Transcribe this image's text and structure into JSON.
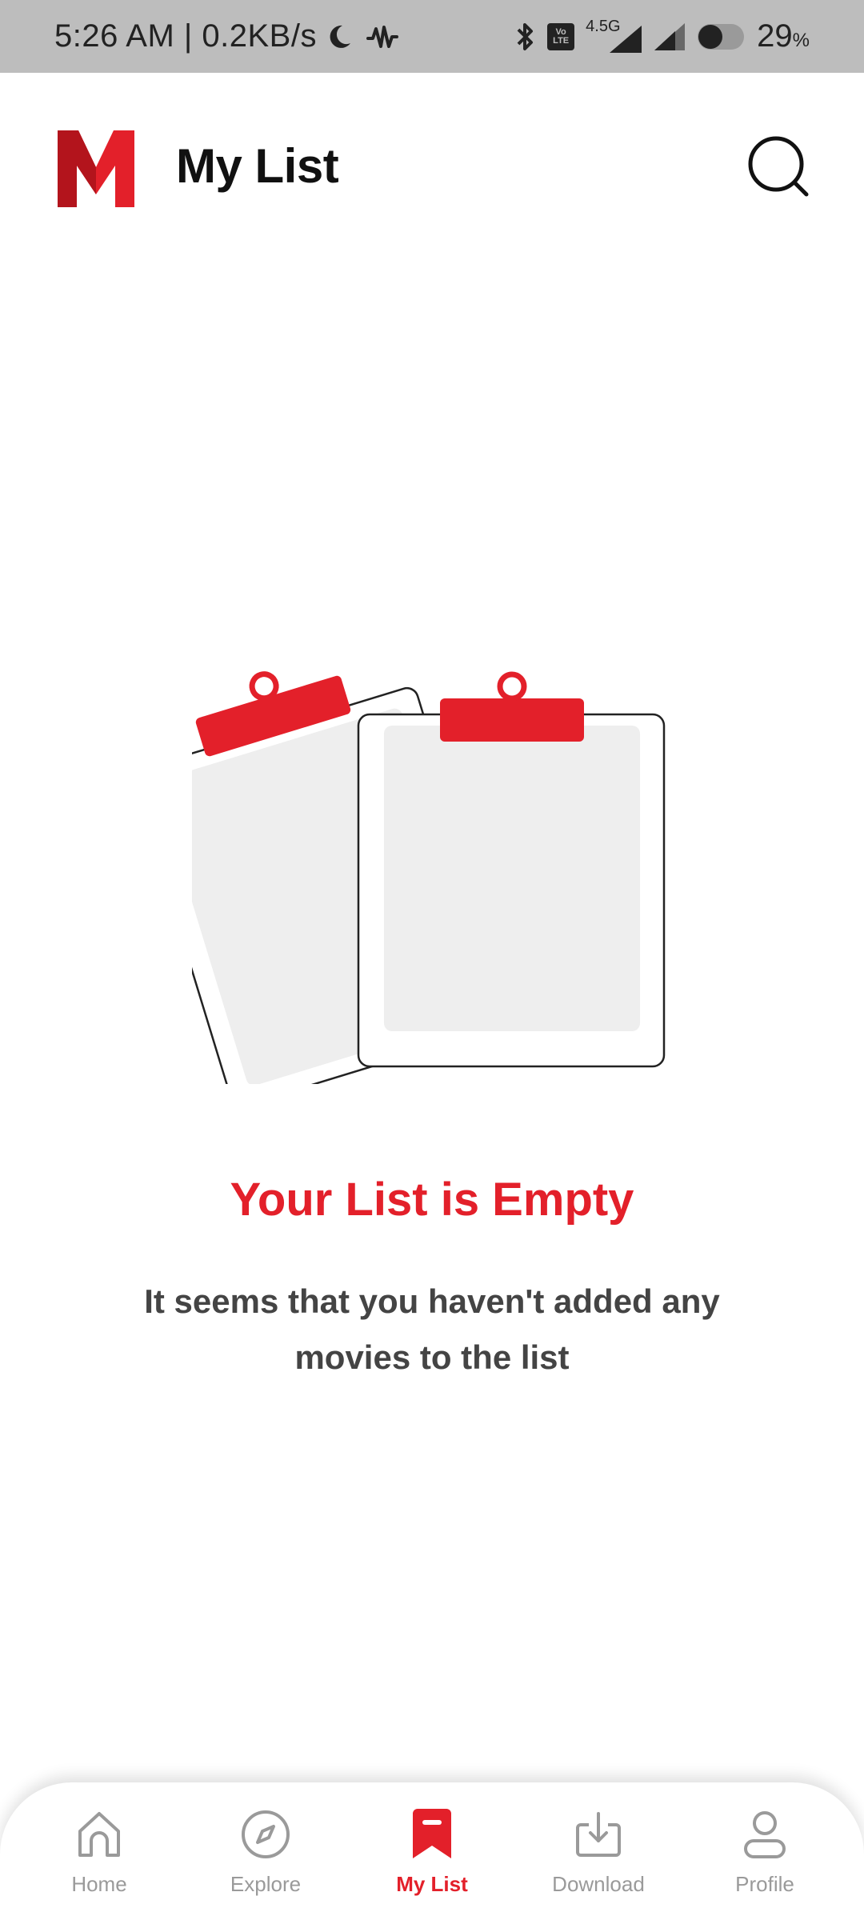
{
  "status_bar": {
    "time_speed": "5:26 AM | 0.2KB/s",
    "network_label": "4.5G",
    "volte_label": "Vo LTE",
    "battery_percent": "29",
    "battery_unit": "%"
  },
  "header": {
    "title": "My List",
    "logo_text": "M"
  },
  "empty_state": {
    "title": "Your List is Empty",
    "description": "It seems that you haven't added any movies to the list"
  },
  "bottom_nav": {
    "items": [
      {
        "label": "Home",
        "icon": "home-icon"
      },
      {
        "label": "Explore",
        "icon": "compass-icon"
      },
      {
        "label": "My List",
        "icon": "bookmark-icon",
        "active": true
      },
      {
        "label": "Download",
        "icon": "download-icon"
      },
      {
        "label": "Profile",
        "icon": "profile-icon"
      }
    ]
  },
  "colors": {
    "accent": "#e3202a",
    "status_bar_bg": "#bdbdbd",
    "inactive": "#9a9a9a"
  }
}
